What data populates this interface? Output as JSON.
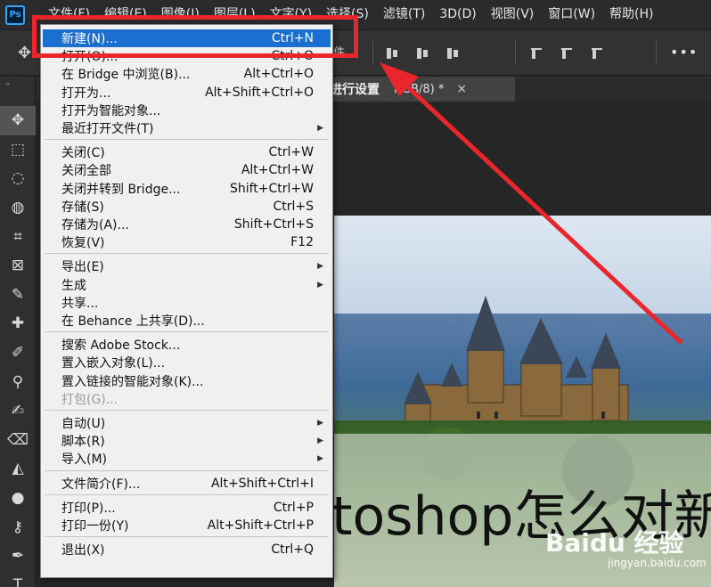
{
  "app": {
    "logo": "Ps"
  },
  "menubar": {
    "items": [
      "文件(F)",
      "编辑(E)",
      "图像(I)",
      "图层(L)",
      "文字(Y)",
      "选择(S)",
      "滤镜(T)",
      "3D(D)",
      "视图(V)",
      "窗口(W)",
      "帮助(H)"
    ]
  },
  "options_bar": {
    "partial_text": "件",
    "more": "•••"
  },
  "document_tab": {
    "name_partial": "进行设置",
    "mode": "RGB/8) *",
    "close": "×"
  },
  "file_menu": {
    "groups": [
      [
        {
          "label": "新建(N)...",
          "shortcut": "Ctrl+N",
          "highlighted": true
        },
        {
          "label": "打开(O)...",
          "shortcut": "Ctrl+O"
        },
        {
          "label": "在 Bridge 中浏览(B)...",
          "shortcut": "Alt+Ctrl+O"
        },
        {
          "label": "打开为...",
          "shortcut": "Alt+Shift+Ctrl+O"
        },
        {
          "label": "打开为智能对象...",
          "shortcut": ""
        },
        {
          "label": "最近打开文件(T)",
          "shortcut": "",
          "submenu": true
        }
      ],
      [
        {
          "label": "关闭(C)",
          "shortcut": "Ctrl+W"
        },
        {
          "label": "关闭全部",
          "shortcut": "Alt+Ctrl+W"
        },
        {
          "label": "关闭并转到 Bridge...",
          "shortcut": "Shift+Ctrl+W"
        },
        {
          "label": "存储(S)",
          "shortcut": "Ctrl+S"
        },
        {
          "label": "存储为(A)...",
          "shortcut": "Shift+Ctrl+S"
        },
        {
          "label": "恢复(V)",
          "shortcut": "F12"
        }
      ],
      [
        {
          "label": "导出(E)",
          "shortcut": "",
          "submenu": true
        },
        {
          "label": "生成",
          "shortcut": "",
          "submenu": true
        },
        {
          "label": "共享...",
          "shortcut": ""
        },
        {
          "label": "在 Behance 上共享(D)...",
          "shortcut": ""
        }
      ],
      [
        {
          "label": "搜索 Adobe Stock...",
          "shortcut": ""
        },
        {
          "label": "置入嵌入对象(L)...",
          "shortcut": ""
        },
        {
          "label": "置入链接的智能对象(K)...",
          "shortcut": ""
        },
        {
          "label": "打包(G)...",
          "shortcut": "",
          "disabled": true
        }
      ],
      [
        {
          "label": "自动(U)",
          "shortcut": "",
          "submenu": true
        },
        {
          "label": "脚本(R)",
          "shortcut": "",
          "submenu": true
        },
        {
          "label": "导入(M)",
          "shortcut": "",
          "submenu": true
        }
      ],
      [
        {
          "label": "文件简介(F)...",
          "shortcut": "Alt+Shift+Ctrl+I"
        }
      ],
      [
        {
          "label": "打印(P)...",
          "shortcut": "Ctrl+P"
        },
        {
          "label": "打印一份(Y)",
          "shortcut": "Alt+Shift+Ctrl+P"
        }
      ],
      [
        {
          "label": "退出(X)",
          "shortcut": "Ctrl+Q"
        }
      ]
    ]
  },
  "canvas": {
    "overlay_text": "toshop怎么对新",
    "watermark": "Baidu 经验",
    "watermark_url": "jingyan.baidu.com"
  },
  "tools": [
    "move-tool",
    "marquee-tool",
    "lasso-tool",
    "quick-select-tool",
    "crop-tool",
    "frame-tool",
    "eyedropper-tool",
    "healing-brush-tool",
    "brush-tool",
    "clone-stamp-tool",
    "history-brush-tool",
    "eraser-tool",
    "paint-bucket-tool",
    "blur-tool",
    "dodge-tool",
    "pen-tool",
    "type-tool"
  ],
  "colors": {
    "highlight": "#1b6fd1",
    "annotation_red": "#e8262b",
    "menu_bg": "#f0f0f0"
  }
}
